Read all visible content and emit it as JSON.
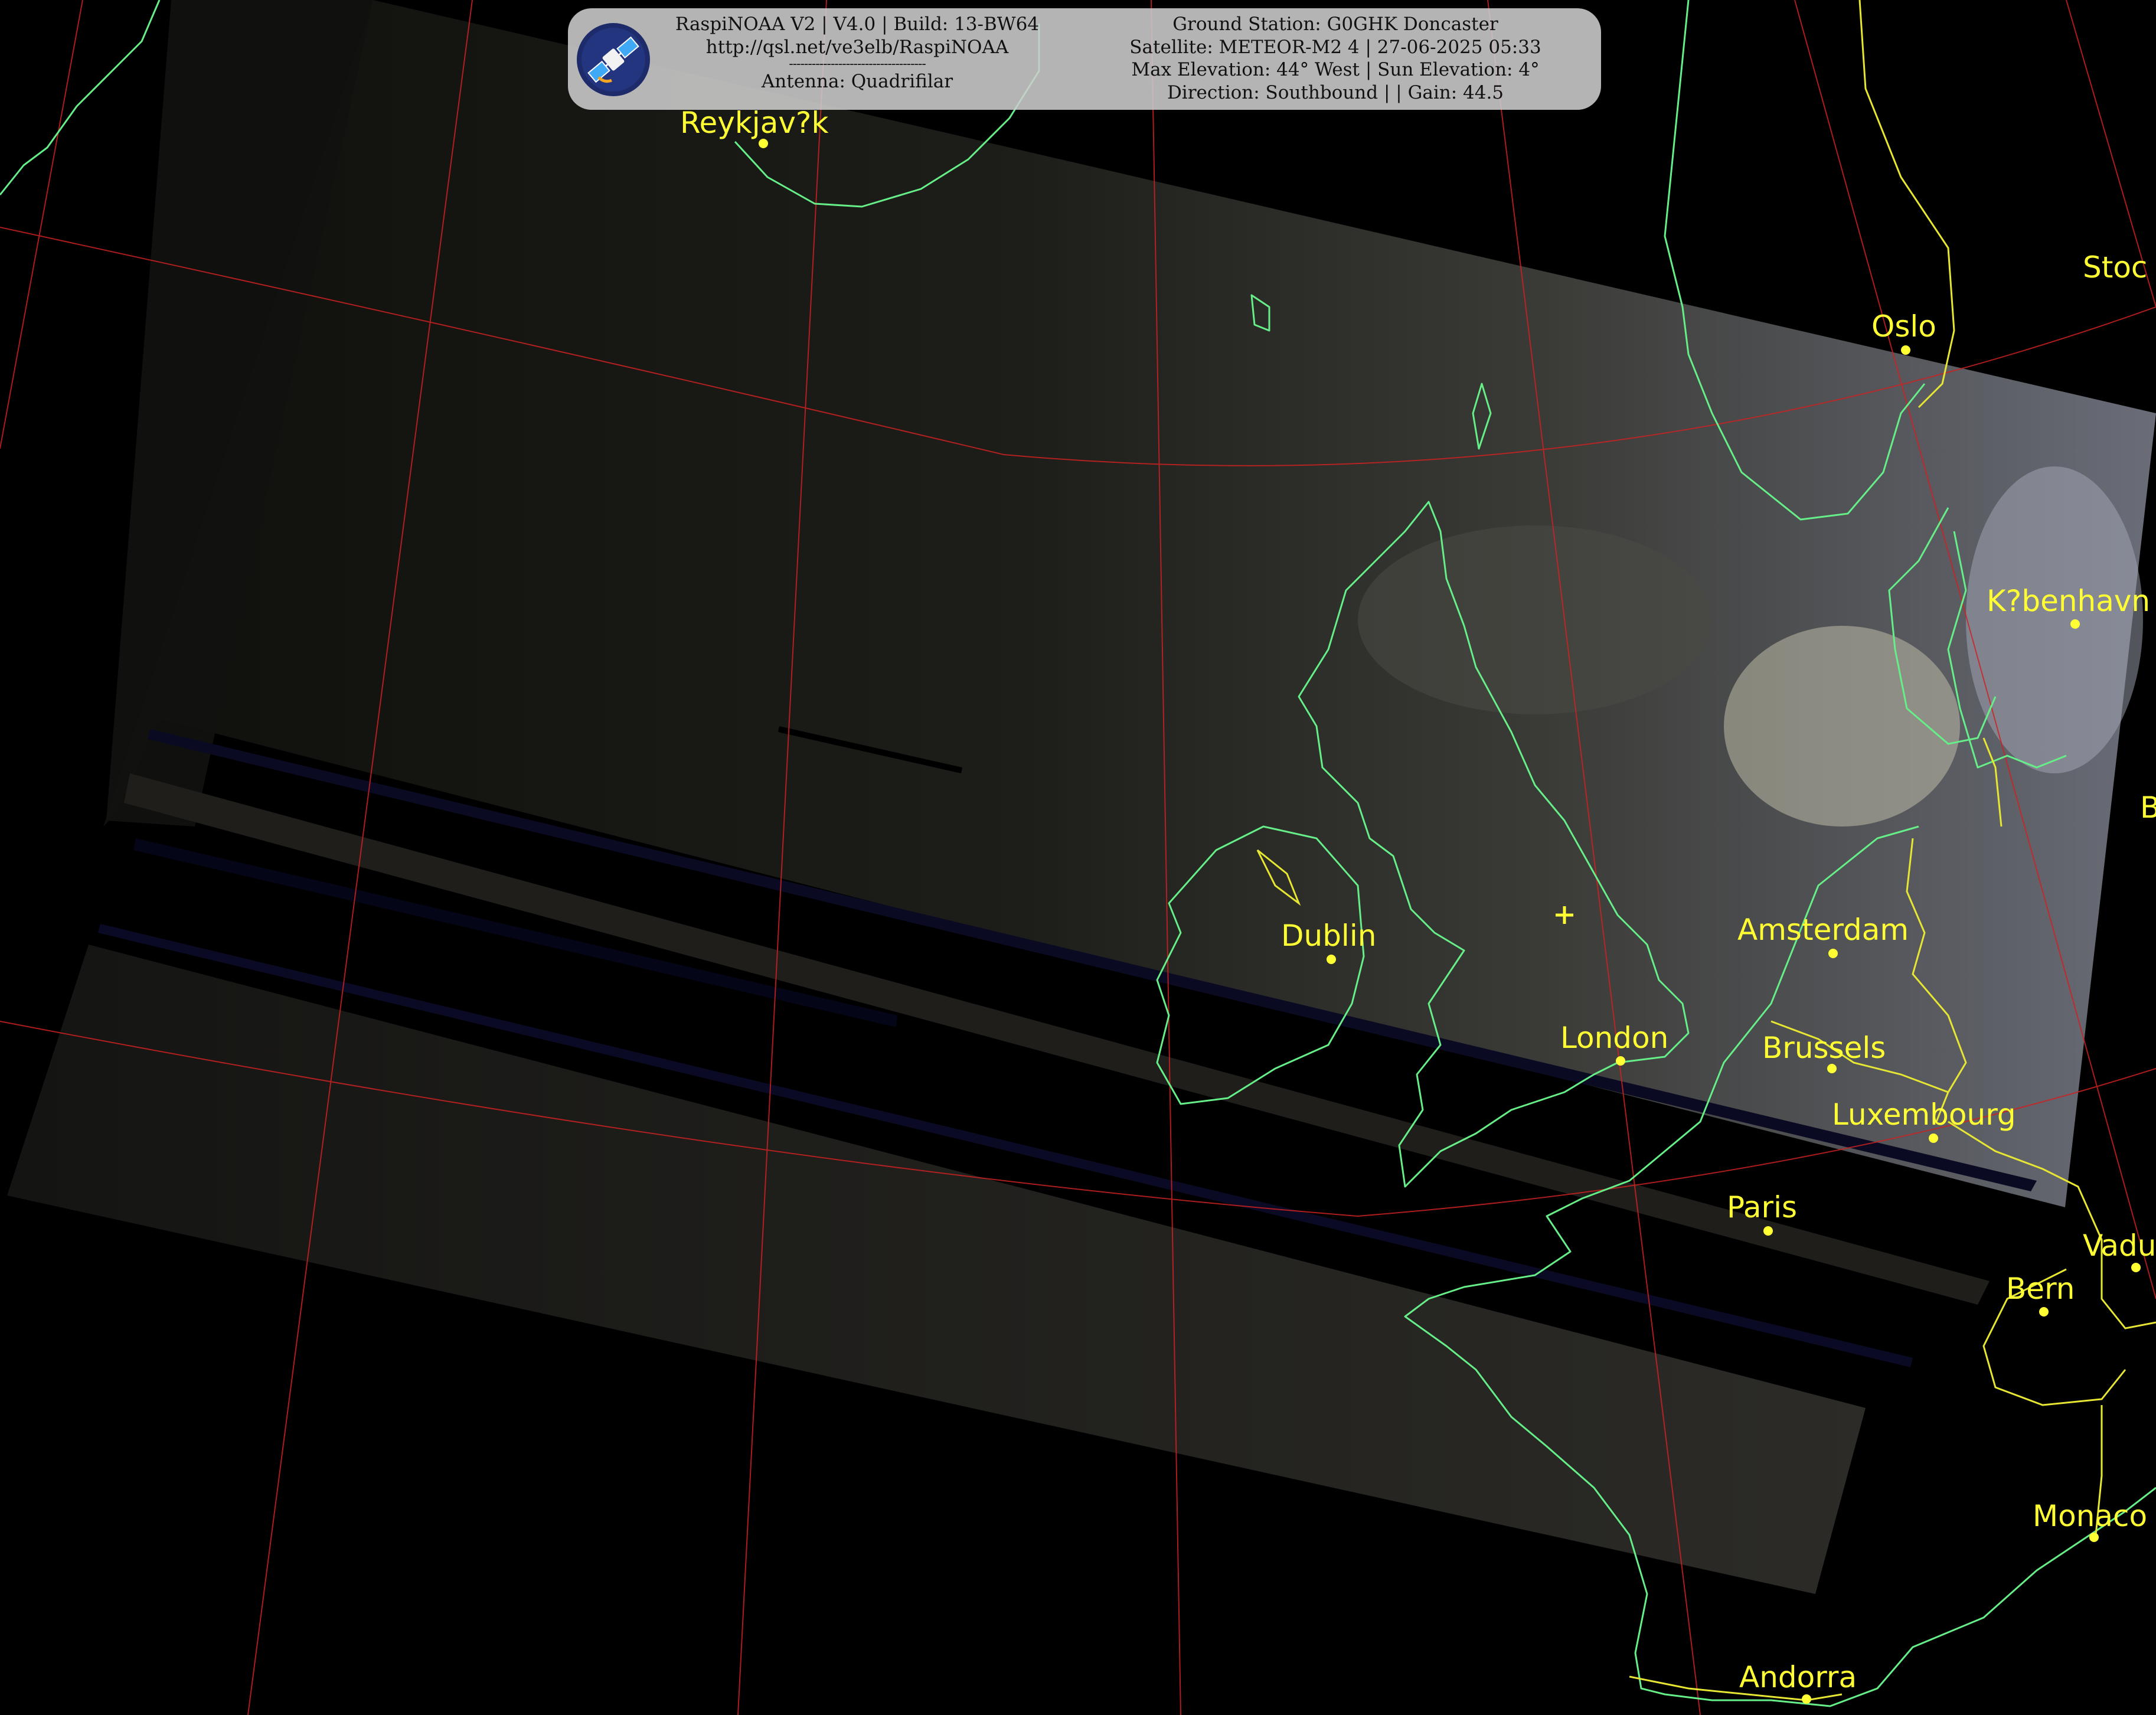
{
  "header": {
    "left": {
      "line1": "RaspiNOAA V2 | V4.0 | Build: 13-BW64",
      "line2": "http://qsl.net/ve3elb/RaspiNOAA",
      "separator": "------------------------------------",
      "line3": "Antenna: Quadrifilar"
    },
    "right": {
      "line1": "Ground Station: G0GHK Doncaster",
      "line2": "Satellite: METEOR-M2 4 | 27-06-2025 05:33",
      "line3": "Max Elevation: 44° West | Sun Elevation: 4°",
      "line4": "Direction: Southbound | | Gain: 44.5"
    },
    "logo_icon": "satellite-logo-icon"
  },
  "cities": {
    "reykjavik": "Reykjav?k",
    "oslo": "Oslo",
    "stockholm": "Stoc",
    "kobenhavn": "K?benhavn",
    "dublin": "Dublin",
    "amsterdam": "Amsterdam",
    "london": "London",
    "brussels": "Brussels",
    "luxembourg": "Luxembourg",
    "paris": "Paris",
    "vaduz": "Vadu",
    "bern": "Bern",
    "monaco": "Monaco",
    "andorra": "Andorra",
    "edge_b": "B"
  },
  "colors": {
    "label": "#ffff33",
    "coastline": "#66ee88",
    "border": "#e6e633",
    "graticule": "#cc2222",
    "ground_station_marker": "#ffff33"
  }
}
